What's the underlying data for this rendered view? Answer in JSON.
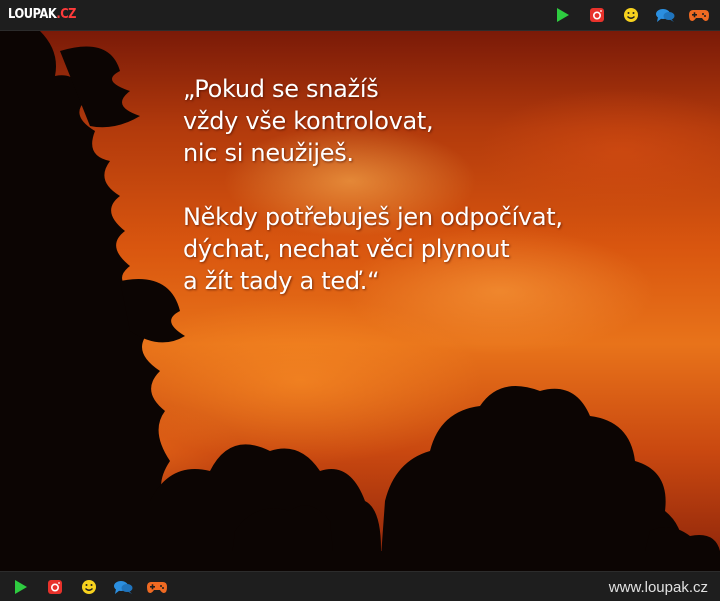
{
  "brand": {
    "logo_main": "LOUPAK",
    "logo_tld": ".CZ",
    "site_url": "www.loupak.cz"
  },
  "icons": {
    "top": [
      "play-icon",
      "instagram-icon",
      "smiley-icon",
      "chat-bubbles-icon",
      "gamepad-icon"
    ],
    "bottom": [
      "play-icon",
      "instagram-icon",
      "smiley-icon",
      "chat-bubbles-icon",
      "gamepad-icon"
    ]
  },
  "colors": {
    "bar_background": "#1e1e1e",
    "logo_accent": "#ff3a3a",
    "play": "#2ecc40",
    "instagram": "#e8322b",
    "smiley": "#f7d21e",
    "chat": "#2b8fe0",
    "gamepad": "#ef6a22"
  },
  "quote": {
    "stanza1": [
      "„Pokud se snažíš",
      "vždy vše kontrolovat,",
      "nic si neužiješ."
    ],
    "stanza2": [
      "Někdy potřebuješ jen odpočívat,",
      "dýchat, nechat věci plynout",
      "a žít tady a teď.“"
    ]
  }
}
